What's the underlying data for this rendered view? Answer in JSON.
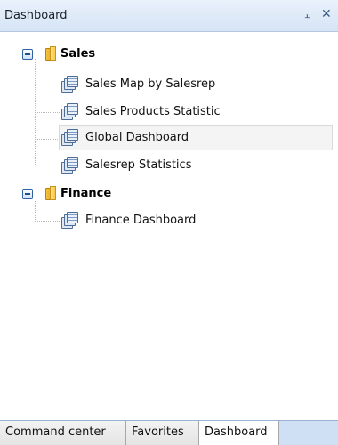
{
  "panel": {
    "title": "Dashboard",
    "pin_icon": "pin-icon",
    "close_icon": "close-icon"
  },
  "tree": {
    "folders": [
      {
        "label": "Sales",
        "expanded": true,
        "items": [
          {
            "label": "Sales Map by Salesrep"
          },
          {
            "label": "Sales Products Statistic"
          },
          {
            "label": "Global Dashboard",
            "selected": true
          },
          {
            "label": "Salesrep Statistics"
          }
        ]
      },
      {
        "label": "Finance",
        "expanded": true,
        "items": [
          {
            "label": "Finance Dashboard"
          }
        ]
      }
    ]
  },
  "tabs": [
    {
      "label": "Command center"
    },
    {
      "label": "Favorites"
    },
    {
      "label": "Dashboard",
      "active": true
    }
  ],
  "colors": {
    "titlebar": "#dbe7f6",
    "tabbar": "#cfe0f5",
    "selection": "#f4f4f4",
    "folder": "#f6c13b"
  }
}
